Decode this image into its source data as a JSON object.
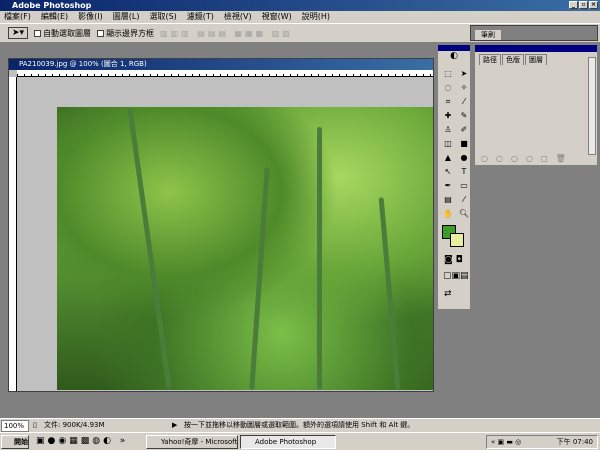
{
  "app": {
    "title": "Adobe Photoshop"
  },
  "menu": [
    "檔案(F)",
    "編輯(E)",
    "影像(I)",
    "圖層(L)",
    "選取(S)",
    "濾鏡(T)",
    "檢視(V)",
    "視窗(W)",
    "說明(H)"
  ],
  "options": {
    "auto_select": "自動選取圖層",
    "show_bounds": "顯示邊界方框"
  },
  "brushes_tab": "筆刷",
  "document": {
    "title": "PA210039.jpg @ 100% (圖合 1, RGB)"
  },
  "panel": {
    "tabs": [
      "路徑",
      "色版",
      "圖層"
    ]
  },
  "colors": {
    "foreground": "#3f9a26",
    "background": "#e8f0a0"
  },
  "status": {
    "zoom": "100%",
    "doc_size": "文件: 900K/4.93M",
    "hint": "按一下並拖移以移動圖層或選取範圍。額外的選項請使用 Shift 和 Alt 鍵。"
  },
  "taskbar": {
    "start": "開始",
    "tasks": [
      "Yahoo!奇摩 - Microsoft I...",
      "Adobe Photoshop"
    ],
    "clock": "下午 07:40"
  }
}
